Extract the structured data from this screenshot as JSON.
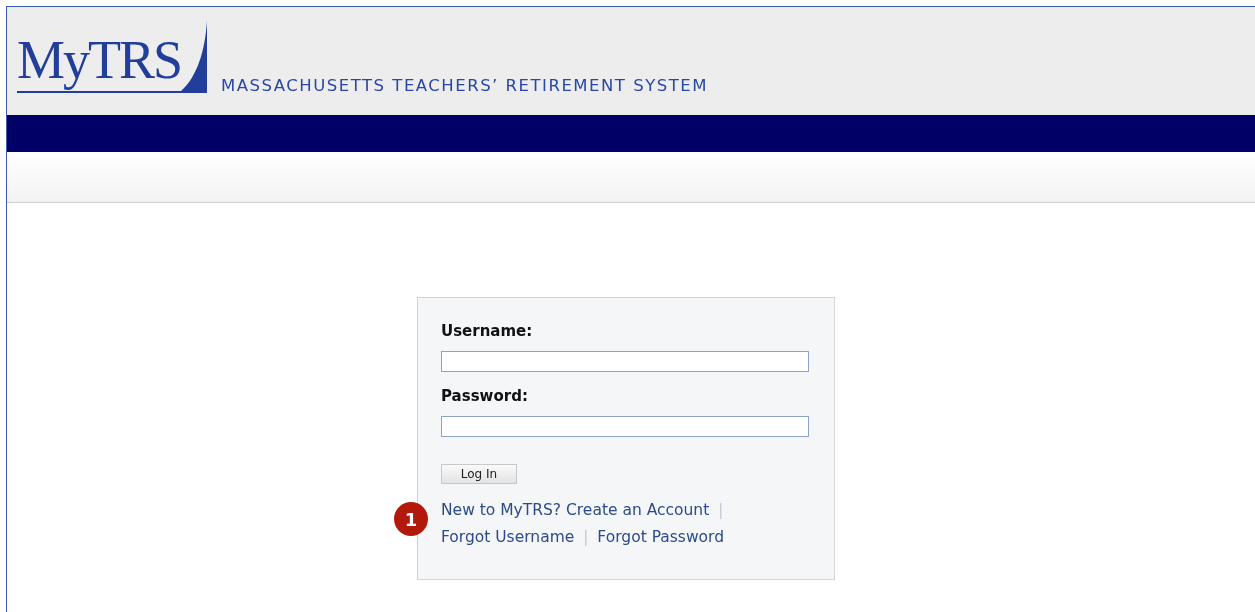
{
  "header": {
    "logo": "MyTRS",
    "tagline": "MASSACHUSETTS TEACHERS’ RETIREMENT SYSTEM"
  },
  "login": {
    "fields": [
      {
        "label": "Username",
        "colon": ":"
      },
      {
        "label": "Password",
        "colon": ":"
      }
    ],
    "button": "Log In",
    "callout": "1",
    "links": [
      [
        {
          "text": "New to MyTRS? Create an Account"
        },
        {
          "separator": "|"
        }
      ],
      [
        {
          "text": "Forgot Username"
        },
        {
          "separator": "|"
        },
        {
          "text": "Forgot Password"
        }
      ]
    ]
  }
}
